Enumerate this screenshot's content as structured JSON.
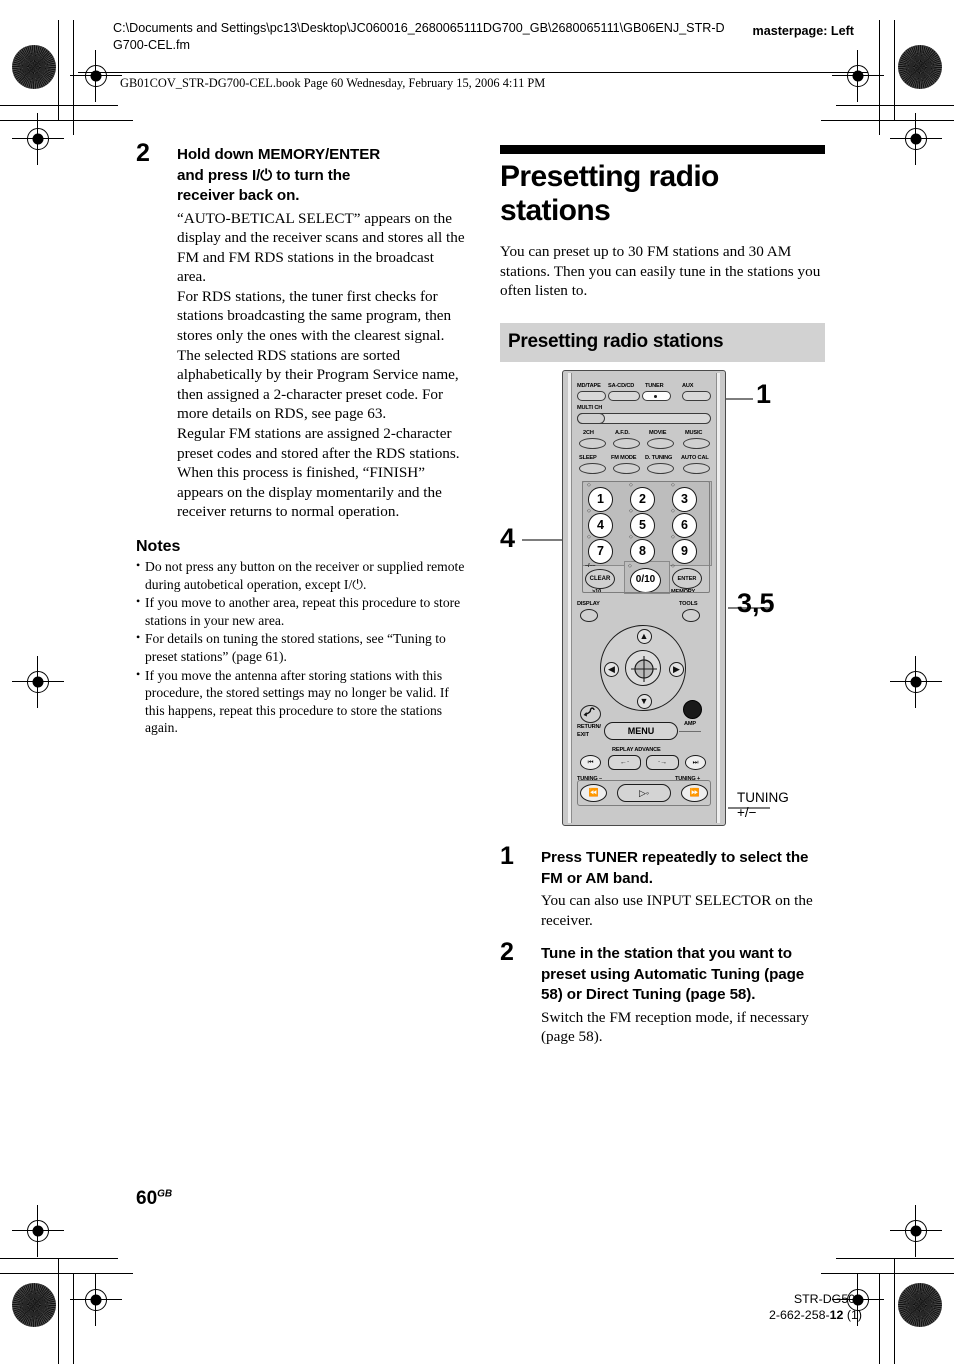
{
  "header": {
    "doc_path": "C:\\Documents and Settings\\pc13\\Desktop\\JC060016_2680065111DG700_GB\\2680065111\\GB06ENJ_STR-DG700-CEL.fm",
    "masterpage": "masterpage: Left",
    "book_line": "GB01COV_STR-DG700-CEL.book  Page 60  Wednesday, February 15, 2006  4:11 PM"
  },
  "left_column": {
    "step": {
      "number": "2",
      "title_line1": "Hold down MEMORY/ENTER",
      "title_line2_pre": "and press ",
      "title_power": "I/⏻",
      "title_line2_post": " to turn the",
      "title_line3": "receiver back on.",
      "paragraphs": [
        "“AUTO-BETICAL SELECT” appears on the display and the receiver scans and stores all the FM and FM RDS stations in the broadcast area.",
        "For RDS stations, the tuner first checks for stations broadcasting the same program, then stores only the ones with the clearest signal. The selected RDS stations are sorted alphabetically by their Program Service name, then assigned a 2-character preset code. For more details on RDS, see page 63.",
        "Regular FM stations are assigned 2-character preset codes and stored after the RDS stations.",
        "When this process is finished, “FINISH” appears on the display momentarily and the receiver returns to normal operation."
      ]
    },
    "notes_heading": "Notes",
    "notes": [
      "Do not press any button on the receiver or supplied remote during autobetical operation, except I/⏻.",
      "If you move to another area, repeat this procedure to store stations in your new area.",
      "For details on tuning the stored stations, see “Tuning to preset stations” (page 61).",
      "If you move the antenna after storing stations with this procedure, the stored settings may no longer be valid. If this happens, repeat this procedure to store the stations again."
    ]
  },
  "right_column": {
    "chapter_title": "Presetting radio stations",
    "intro": "You can preset up to 30 FM stations and 30 AM stations. Then you can easily tune in the stations you often listen to.",
    "section_title": "Presetting radio stations",
    "steps": [
      {
        "number": "1",
        "title": "Press TUNER repeatedly to select the FM or AM band.",
        "text": "You can also use INPUT SELECTOR on the receiver."
      },
      {
        "number": "2",
        "title": "Tune in the station that you want to preset using Automatic Tuning (page 58) or Direct Tuning (page 58).",
        "text": "Switch the FM reception mode, if necessary (page 58)."
      }
    ]
  },
  "figure": {
    "callouts": {
      "tuner": "1",
      "keypad": "4",
      "enter": "3,5",
      "tuning_line1": "TUNING",
      "tuning_line2": "+/−"
    },
    "remote": {
      "source_row": [
        "MD/TAPE",
        "SA-CD/CD",
        "TUNER",
        "AUX"
      ],
      "multi_ch": "MULTI CH",
      "field_row": [
        "2CH",
        "A.F.D.",
        "MOVIE",
        "MUSIC"
      ],
      "func_row": [
        "SLEEP",
        "FM MODE",
        "D. TUNING",
        "AUTO CAL"
      ],
      "numbers": [
        "1",
        "2",
        "3",
        "4",
        "5",
        "6",
        "7",
        "8",
        "9"
      ],
      "clear_top": "–/––",
      "clear": "CLEAR",
      "clear_sub": ">10",
      "zero": "0/10",
      "enter": "ENTER",
      "enter_sub": "MEMORY",
      "display": "DISPLAY",
      "tools": "TOOLS",
      "return_line1": "RETURN/",
      "return_line2": "EXIT",
      "menu": "MENU",
      "amp": "AMP",
      "replay_advance": "REPLAY ADVANCE",
      "tuning_minus": "TUNING –",
      "tuning_plus": "TUNING +"
    }
  },
  "footer": {
    "page_number": "60",
    "page_suffix": "GB",
    "model": "STR-DG500",
    "part_number_pre": "2-662-258-",
    "part_number_bold": "12",
    "part_number_post": " (1)"
  }
}
